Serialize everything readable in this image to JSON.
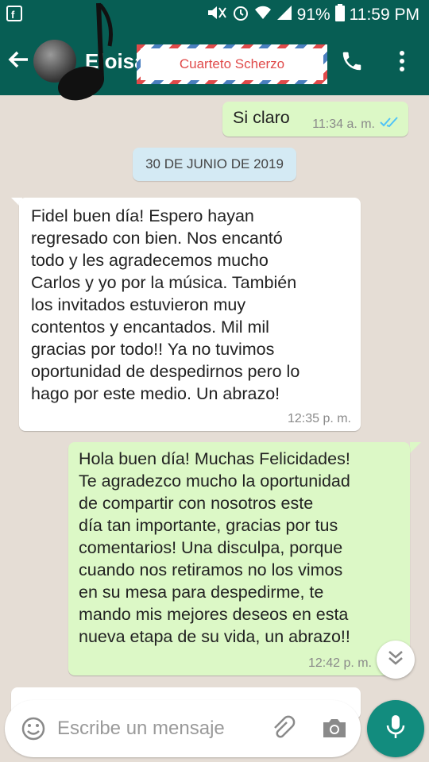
{
  "status_bar": {
    "battery": "91%",
    "time": "11:59 PM"
  },
  "header": {
    "contact_name": "Eloisa",
    "banner_text": "Cuarteto Scherzo"
  },
  "composer": {
    "placeholder": "Escribe un mensaje"
  },
  "messages": [
    {
      "direction": "out",
      "text": "Si claro",
      "time": "11:34 a. m.",
      "status": "read"
    },
    {
      "type": "date",
      "label": "30 DE JUNIO DE 2019"
    },
    {
      "direction": "in",
      "lines": [
        "Fidel buen día! Espero hayan",
        "regresado con bien. Nos encantó",
        "todo y les agradecemos mucho",
        "Carlos y yo por la música. También",
        "los invitados estuvieron muy",
        "contentos y encantados. Mil mil",
        "gracias por todo!! Ya no tuvimos",
        "oportunidad de despedirnos pero lo",
        "hago por este medio. Un abrazo!"
      ],
      "time": "12:35 p. m."
    },
    {
      "direction": "out",
      "lines": [
        "Hola buen día! Muchas Felicidades!",
        "Te agradezco mucho la oportunidad",
        "de compartir con nosotros este",
        "día tan importante, gracias por tus",
        "comentarios! Una disculpa, porque",
        "cuando nos retiramos no los vimos",
        "en su mesa para despedirme, te",
        "mando mis mejores deseos en esta",
        "nueva etapa de su vida, un abrazo!!"
      ],
      "time": "12:42 p. m."
    }
  ],
  "icons": {
    "read_color": "#4fc3f7",
    "header_color": "#075e54",
    "fab_color": "#128c7e"
  }
}
